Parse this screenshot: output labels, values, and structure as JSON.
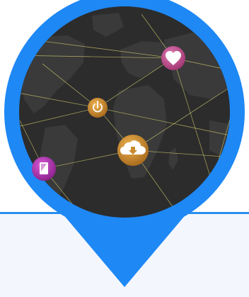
{
  "colors": {
    "pin_blue": "#1e88f5",
    "panel_bg": "#f3f7fd",
    "panel_border": "#2b8ff0",
    "map_bg": "#2c2c2c",
    "continent": "#3a3a3a",
    "network_line": "#c8c36a",
    "pink_node": "#c2508e",
    "orange_node": "#c88a2c",
    "purple_node": "#b12fb0"
  },
  "nodes": [
    {
      "name": "heart-node",
      "icon": "heart-icon",
      "color": "#c2508e"
    },
    {
      "name": "power-node",
      "icon": "power-icon",
      "color": "#c88a2c"
    },
    {
      "name": "cloud-download-node",
      "icon": "cloud-download-icon",
      "color": "#c88a2c"
    },
    {
      "name": "tablet-node",
      "icon": "tablet-icon",
      "color": "#b12fb0"
    }
  ]
}
